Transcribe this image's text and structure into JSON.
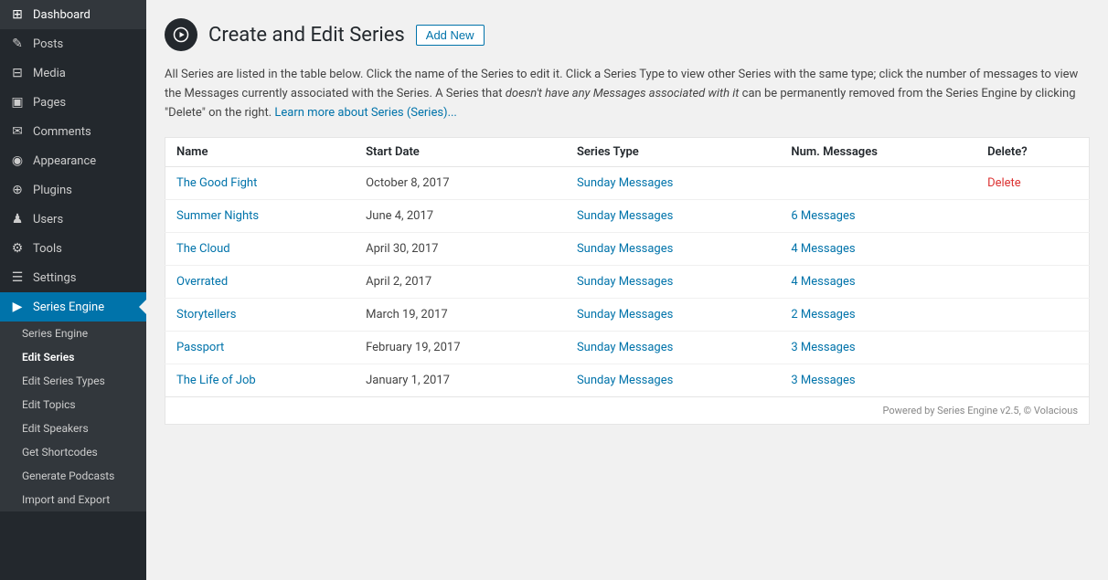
{
  "sidebar": {
    "items": [
      {
        "label": "Dashboard",
        "icon": "⊞",
        "name": "dashboard"
      },
      {
        "label": "Posts",
        "icon": "✎",
        "name": "posts"
      },
      {
        "label": "Media",
        "icon": "⊟",
        "name": "media"
      },
      {
        "label": "Pages",
        "icon": "▣",
        "name": "pages"
      },
      {
        "label": "Comments",
        "icon": "✉",
        "name": "comments"
      },
      {
        "label": "Appearance",
        "icon": "◉",
        "name": "appearance"
      },
      {
        "label": "Plugins",
        "icon": "⊕",
        "name": "plugins"
      },
      {
        "label": "Users",
        "icon": "♟",
        "name": "users"
      },
      {
        "label": "Tools",
        "icon": "⚙",
        "name": "tools"
      },
      {
        "label": "Settings",
        "icon": "☰",
        "name": "settings"
      },
      {
        "label": "Series Engine",
        "icon": "▶",
        "name": "series-engine",
        "active": true
      }
    ],
    "submenu": [
      {
        "label": "Series Engine",
        "name": "submenu-series-engine"
      },
      {
        "label": "Edit Series",
        "name": "submenu-edit-series",
        "active": true
      },
      {
        "label": "Edit Series Types",
        "name": "submenu-edit-series-types"
      },
      {
        "label": "Edit Topics",
        "name": "submenu-edit-topics"
      },
      {
        "label": "Edit Speakers",
        "name": "submenu-edit-speakers"
      },
      {
        "label": "Get Shortcodes",
        "name": "submenu-get-shortcodes"
      },
      {
        "label": "Generate Podcasts",
        "name": "submenu-generate-podcasts"
      },
      {
        "label": "Import and Export",
        "name": "submenu-import-export"
      }
    ]
  },
  "page": {
    "title": "Create and Edit Series",
    "add_new_label": "Add New",
    "description_1": "All Series are listed in the table below. Click the name of the Series to edit it. Click a Series Type to view other Series with the same type; click the number of messages to view the Messages currently associated with the Series. A Series that ",
    "description_em": "doesn't have any Messages associated with it",
    "description_2": " can be permanently removed from the Series Engine by clicking \"Delete\" on the right.",
    "description_link": "Learn more about Series (Series)...",
    "table": {
      "columns": [
        "Name",
        "Start Date",
        "Series Type",
        "Num. Messages",
        "Delete?"
      ],
      "rows": [
        {
          "name": "The Good Fight",
          "start_date": "October 8, 2017",
          "series_type": "Sunday Messages",
          "num_messages": "",
          "delete": "Delete"
        },
        {
          "name": "Summer Nights",
          "start_date": "June 4, 2017",
          "series_type": "Sunday Messages",
          "num_messages": "6 Messages",
          "delete": ""
        },
        {
          "name": "The Cloud",
          "start_date": "April 30, 2017",
          "series_type": "Sunday Messages",
          "num_messages": "4 Messages",
          "delete": ""
        },
        {
          "name": "Overrated",
          "start_date": "April 2, 2017",
          "series_type": "Sunday Messages",
          "num_messages": "4 Messages",
          "delete": ""
        },
        {
          "name": "Storytellers",
          "start_date": "March 19, 2017",
          "series_type": "Sunday Messages",
          "num_messages": "2 Messages",
          "delete": ""
        },
        {
          "name": "Passport",
          "start_date": "February 19, 2017",
          "series_type": "Sunday Messages",
          "num_messages": "3 Messages",
          "delete": ""
        },
        {
          "name": "The Life of Job",
          "start_date": "January 1, 2017",
          "series_type": "Sunday Messages",
          "num_messages": "3 Messages",
          "delete": ""
        }
      ]
    },
    "footer": "Powered by Series Engine v2.5, © Volacious"
  }
}
